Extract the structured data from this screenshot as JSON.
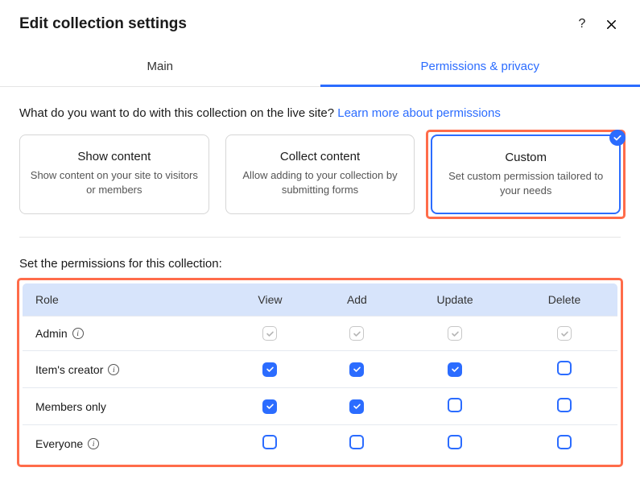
{
  "dialog_title": "Edit collection settings",
  "tabs": {
    "main": "Main",
    "permissions": "Permissions & privacy"
  },
  "prompt": "What do you want to do with this collection on the live site?",
  "learn_more": "Learn more about permissions",
  "cards": {
    "show": {
      "title": "Show content",
      "desc": "Show content on your site to visitors or members"
    },
    "collect": {
      "title": "Collect content",
      "desc": "Allow adding to your collection by submitting forms"
    },
    "custom": {
      "title": "Custom",
      "desc": "Set custom permission tailored to your needs"
    }
  },
  "perm_heading": "Set the permissions for this collection:",
  "columns": {
    "role": "Role",
    "view": "View",
    "add": "Add",
    "update": "Update",
    "delete": "Delete"
  },
  "roles": {
    "admin": {
      "label": "Admin",
      "has_info": true,
      "view": "locked",
      "add": "locked",
      "update": "locked",
      "delete": "locked"
    },
    "creator": {
      "label": "Item's creator",
      "has_info": true,
      "view": "on",
      "add": "on",
      "update": "on",
      "delete": "off"
    },
    "members": {
      "label": "Members only",
      "has_info": false,
      "view": "on",
      "add": "on",
      "update": "off",
      "delete": "off"
    },
    "everyone": {
      "label": "Everyone",
      "has_info": true,
      "view": "off",
      "add": "off",
      "update": "off",
      "delete": "off"
    }
  }
}
